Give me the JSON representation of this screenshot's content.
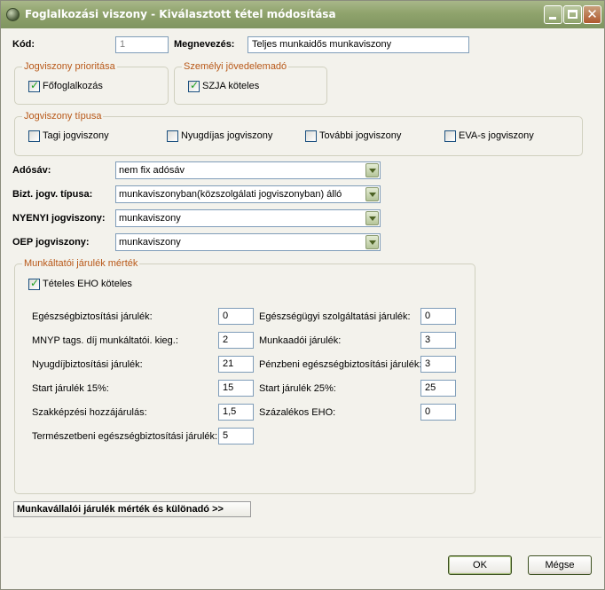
{
  "window": {
    "title": "Foglalkozási viszony - Kiválasztott tétel módosítása",
    "close_glyph": "✕"
  },
  "icons": [
    "app-icon",
    "minimize-icon",
    "maximize-icon",
    "close-icon",
    "chevron-down-icon",
    "checkbox-checked-icon"
  ],
  "colors": {
    "titlebar": "#8fa36c",
    "group_title": "#b85818",
    "check": "#21a121"
  },
  "header": {
    "kod_label": "Kód:",
    "kod_value": "1",
    "megnevezes_label": "Megnevezés:",
    "megnevezes_value": "Teljes munkaidős munkaviszony"
  },
  "prioritas": {
    "title": "Jogviszony prioritása",
    "foglalkozas_label": "Főfoglalkozás",
    "foglalkozas_checked": true
  },
  "jovedelemado": {
    "title": "Személyi jövedelemadó",
    "szja_label": "SZJA köteles",
    "szja_checked": true
  },
  "tipus": {
    "title": "Jogviszony típusa",
    "options": [
      {
        "label": "Tagi jogviszony",
        "checked": false
      },
      {
        "label": "Nyugdíjas jogviszony",
        "checked": false
      },
      {
        "label": "További jogviszony",
        "checked": false
      },
      {
        "label": "EVA-s jogviszony",
        "checked": false
      }
    ]
  },
  "combos": {
    "adosav_label": "Adósáv:",
    "adosav_value": "nem fix adósáv",
    "bizt_label": "Bizt. jogv. típusa:",
    "bizt_value": "munkaviszonyban(közszolgálati jogviszonyban) álló",
    "nyenyi_label": "NYENYI jogviszony:",
    "nyenyi_value": "munkaviszony",
    "oep_label": "OEP jogviszony:",
    "oep_value": "munkaviszony"
  },
  "munkaltatoi": {
    "title": "Munkáltatói járulék mérték",
    "eho_label": "Tételes EHO köteles",
    "eho_checked": true,
    "left_fields": [
      {
        "label": "Egészségbiztosítási járulék:",
        "value": "0"
      },
      {
        "label": "MNYP tags. díj munkáltatói. kieg.:",
        "value": "2"
      },
      {
        "label": "Nyugdíjbiztosítási járulék:",
        "value": "21"
      },
      {
        "label": "Start járulék 15%:",
        "value": "15"
      },
      {
        "label": "Szakképzési hozzájárulás:",
        "value": "1,5"
      },
      {
        "label": "Természetbeni egészségbiztosítási járulék:",
        "value": "5"
      }
    ],
    "right_fields": [
      {
        "label": "Egészségügyi szolgáltatási járulék:",
        "value": "0"
      },
      {
        "label": "Munkaadói járulék:",
        "value": "3"
      },
      {
        "label": "Pénzbeni egészségbiztosítási járulék:",
        "value": "3"
      },
      {
        "label": "Start járulék 25%:",
        "value": "25"
      },
      {
        "label": "Százalékos EHO:",
        "value": "0"
      }
    ]
  },
  "munkavallaloi_button": "Munkavállalói járulék mérték és különadó  >>",
  "buttons": {
    "ok": "OK",
    "cancel": "Mégse"
  }
}
